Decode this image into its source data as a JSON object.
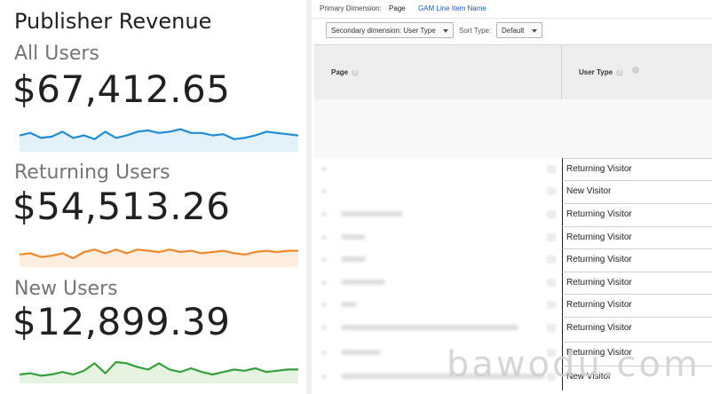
{
  "left_panel": {
    "title": "Publisher Revenue",
    "segments": [
      {
        "label": "All Users",
        "value": "$67,412.65",
        "color": "#1f8dd6",
        "fill": "#e3f1fb",
        "trend": [
          0.45,
          0.35,
          0.55,
          0.5,
          0.3,
          0.55,
          0.45,
          0.6,
          0.3,
          0.55,
          0.45,
          0.3,
          0.25,
          0.35,
          0.3,
          0.2,
          0.35,
          0.35,
          0.45,
          0.4,
          0.6,
          0.55,
          0.45,
          0.3,
          0.35,
          0.4,
          0.45
        ]
      },
      {
        "label": "Returning Users",
        "value": "$54,513.26",
        "color": "#ef8a2c",
        "fill": "#fdeee0",
        "trend": [
          0.6,
          0.55,
          0.7,
          0.65,
          0.55,
          0.75,
          0.5,
          0.4,
          0.55,
          0.4,
          0.55,
          0.4,
          0.45,
          0.5,
          0.4,
          0.5,
          0.45,
          0.55,
          0.5,
          0.45,
          0.55,
          0.6,
          0.5,
          0.45,
          0.5,
          0.45,
          0.45
        ]
      },
      {
        "label": "New Users",
        "value": "$12,899.39",
        "color": "#34a23b",
        "fill": "#e6f3e1",
        "trend": [
          0.75,
          0.7,
          0.8,
          0.75,
          0.65,
          0.75,
          0.6,
          0.3,
          0.7,
          0.25,
          0.3,
          0.45,
          0.55,
          0.3,
          0.55,
          0.65,
          0.5,
          0.65,
          0.75,
          0.65,
          0.55,
          0.6,
          0.5,
          0.65,
          0.6,
          0.55,
          0.55
        ]
      }
    ]
  },
  "report": {
    "primary_dimension_label": "Primary Dimension:",
    "primary_active": "Page",
    "primary_link": "GAM Line Item Name",
    "secondary_dropdown": "Secondary dimension: User Type",
    "sort_label": "Sort Type:",
    "sort_dropdown": "Default",
    "columns": {
      "page": "Page",
      "user_type": "User Type"
    },
    "rows": [
      {
        "user_type": "Returning Visitor"
      },
      {
        "user_type": "New Visitor"
      },
      {
        "user_type": "Returning Visitor"
      },
      {
        "user_type": "Returning Visitor"
      },
      {
        "user_type": "Returning Visitor"
      },
      {
        "user_type": "Returning Visitor"
      },
      {
        "user_type": "Returning Visitor"
      },
      {
        "user_type": "Returning Visitor"
      },
      {
        "user_type": "Returning Visitor"
      },
      {
        "user_type": "New Visitor"
      }
    ]
  },
  "watermark": "bawodu.com"
}
